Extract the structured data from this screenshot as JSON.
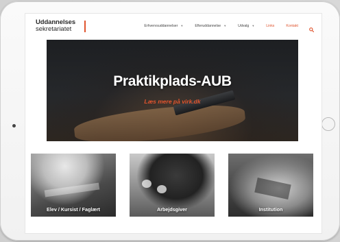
{
  "header": {
    "logo": {
      "line1": "Uddannelses",
      "line2": "sekretariatet"
    },
    "nav": [
      {
        "label": "Erhvervsuddannelser",
        "dropdown": true
      },
      {
        "label": "Efteruddannelse",
        "dropdown": true
      },
      {
        "label": "Udvalg",
        "dropdown": true
      },
      {
        "label": "Links",
        "dropdown": false
      },
      {
        "label": "Kontakt",
        "dropdown": false
      }
    ]
  },
  "hero": {
    "title": "Praktikplads-AUB",
    "link": "Læs mere på virk.dk"
  },
  "cards": [
    {
      "label": "Elev / Kursist / Faglært"
    },
    {
      "label": "Arbejdsgiver"
    },
    {
      "label": "Institution"
    }
  ],
  "icons": {
    "search": "search-icon",
    "dropdown": "chevron-down-icon"
  },
  "colors": {
    "accent": "#e0542e",
    "text": "#444444",
    "background": "#ffffff"
  }
}
